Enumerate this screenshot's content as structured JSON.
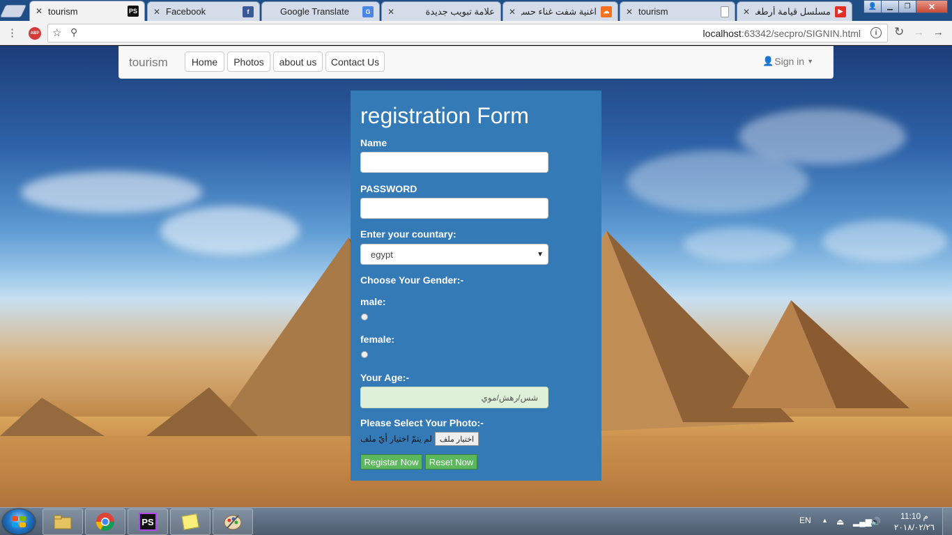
{
  "browser": {
    "tabs": [
      {
        "title": "tourism",
        "favicon": "phpstorm-icon",
        "active": true
      },
      {
        "title": "Facebook",
        "favicon": "facebook-icon",
        "active": false
      },
      {
        "title": "Google Translate",
        "favicon": "google-translate-icon",
        "active": false
      },
      {
        "title": "علامة تبويب جديدة",
        "favicon": "",
        "active": false
      },
      {
        "title": "اغنية شفت غناء حسين",
        "favicon": "soundcloud-icon",
        "active": false
      },
      {
        "title": "tourism",
        "favicon": "page-icon",
        "active": false
      },
      {
        "title": "مسلسل قيامة أرطغرل المو",
        "favicon": "youtube-icon",
        "active": false
      }
    ],
    "url_host": "localhost",
    "url_rest": ":63342/secpro/SIGNIN.html",
    "extension_badge": "ABP"
  },
  "navbar": {
    "brand": "tourism",
    "links": [
      "Home",
      "Photos",
      "about us",
      "Contact Us"
    ],
    "signin": "Sign in"
  },
  "form": {
    "title": "registration Form",
    "name_label": "Name",
    "password_label": "PASSWORD",
    "country_label": "Enter your countary:",
    "country_value": "egypt",
    "gender_label": "Choose Your Gender:-",
    "male_label": "male:",
    "female_label": "female:",
    "age_label": "Your Age:-",
    "age_placeholder": "شس/رهش/موي",
    "photo_label": "Please Select Your Photo:-",
    "file_button": "اختيار ملف",
    "file_status": "لم يتمّ اختيار أيّ ملف",
    "register_button": "Registar Now",
    "reset_button": "Reset Now"
  },
  "taskbar": {
    "language": "EN",
    "time": "11:10 م",
    "date": "٢٠١٨/٠٢/٢٦"
  },
  "colors": {
    "form_bg": "#337ab7",
    "button_green": "#5cb85c",
    "age_bg": "#dff0d8"
  }
}
